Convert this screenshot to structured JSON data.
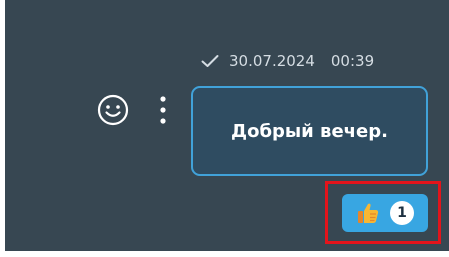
{
  "message": {
    "date": "30.07.2024",
    "time": "00:39",
    "text": "Добрый вечер.",
    "status_icon": "checkmark-icon"
  },
  "actions": {
    "emoji_icon": "smiley-icon",
    "menu_icon": "kebab-menu-icon"
  },
  "reaction": {
    "emoji": "thumbs-up-icon",
    "count": "1"
  },
  "colors": {
    "background": "#374752",
    "bubble_fill": "#2f4c61",
    "bubble_border": "#41a2d9",
    "reaction_fill": "#38a6e2",
    "highlight": "#e3141b"
  }
}
